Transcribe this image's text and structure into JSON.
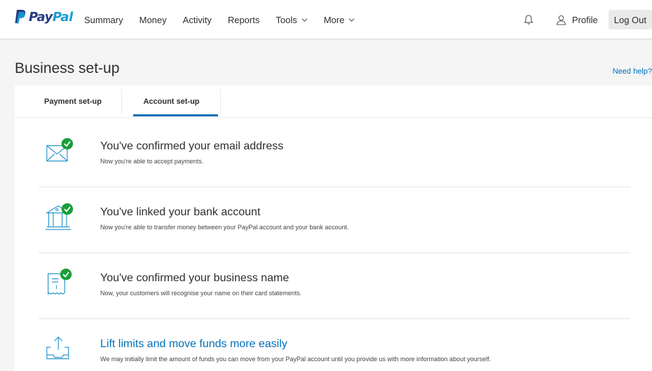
{
  "header": {
    "logo_part1": "Pay",
    "logo_part2": "Pal",
    "nav": [
      "Summary",
      "Money",
      "Activity",
      "Reports",
      "Tools",
      "More"
    ],
    "profile_label": "Profile",
    "logout_label": "Log Out"
  },
  "page": {
    "title": "Business set-up",
    "help_link": "Need help?"
  },
  "tabs": [
    {
      "label": "Payment set-up",
      "active": false
    },
    {
      "label": "Account set-up",
      "active": true
    }
  ],
  "items": [
    {
      "icon": "envelope-check-icon",
      "title": "You've confirmed your email address",
      "desc": "Now you're able to accept payments.",
      "done": true
    },
    {
      "icon": "bank-check-icon",
      "title": "You've linked your bank account",
      "desc": "Now you're able to transfer money between your PayPal account and your bank account.",
      "done": true
    },
    {
      "icon": "receipt-check-icon",
      "title": "You've confirmed your business name",
      "desc": "Now, your customers will recognise your name on their card statements.",
      "done": true
    },
    {
      "icon": "upload-tray-icon",
      "title": "Lift limits and move funds more easily",
      "desc": "We may initially limit the amount of funds you can move from your PayPal account until you provide us with more information about yourself.",
      "done": false
    }
  ],
  "colors": {
    "accent": "#0070ba",
    "success": "#1a9e3a",
    "icon_stroke": "#1a8fc9"
  }
}
